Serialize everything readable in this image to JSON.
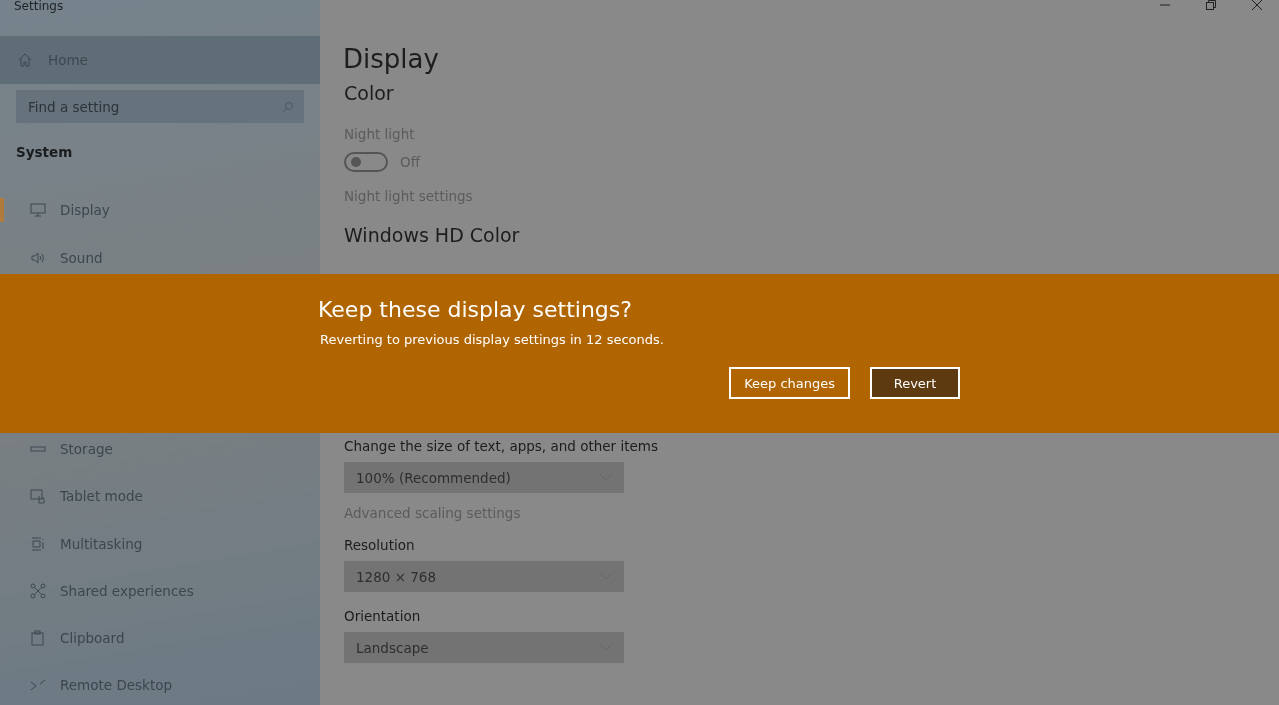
{
  "window": {
    "title": "Settings"
  },
  "sidebar": {
    "home": "Home",
    "search": {
      "placeholder": "Find a setting"
    },
    "section": "System",
    "items": [
      {
        "label": "Display",
        "selected": true
      },
      {
        "label": "Sound",
        "selected": false
      },
      {
        "label": "Storage",
        "selected": false
      },
      {
        "label": "Tablet mode",
        "selected": false
      },
      {
        "label": "Multitasking",
        "selected": false
      },
      {
        "label": "Shared experiences",
        "selected": false
      },
      {
        "label": "Clipboard",
        "selected": false
      },
      {
        "label": "Remote Desktop",
        "selected": false
      }
    ]
  },
  "main": {
    "title": "Display",
    "color_heading": "Color",
    "night_light": {
      "label": "Night light",
      "on": false,
      "state_text": "Off"
    },
    "night_light_link": "Night light settings",
    "hd_heading": "Windows HD Color",
    "scale": {
      "label": "Change the size of text, apps, and other items",
      "value": "100% (Recommended)"
    },
    "scaling_link": "Advanced scaling settings",
    "resolution": {
      "label": "Resolution",
      "value": "1280 × 768"
    },
    "orientation": {
      "label": "Orientation",
      "value": "Landscape"
    }
  },
  "banner": {
    "title": "Keep these display settings?",
    "message": "Reverting to previous display settings in 12 seconds.",
    "buttons": [
      {
        "label": "Keep changes",
        "default": false
      },
      {
        "label": "Revert",
        "default": true
      }
    ]
  }
}
